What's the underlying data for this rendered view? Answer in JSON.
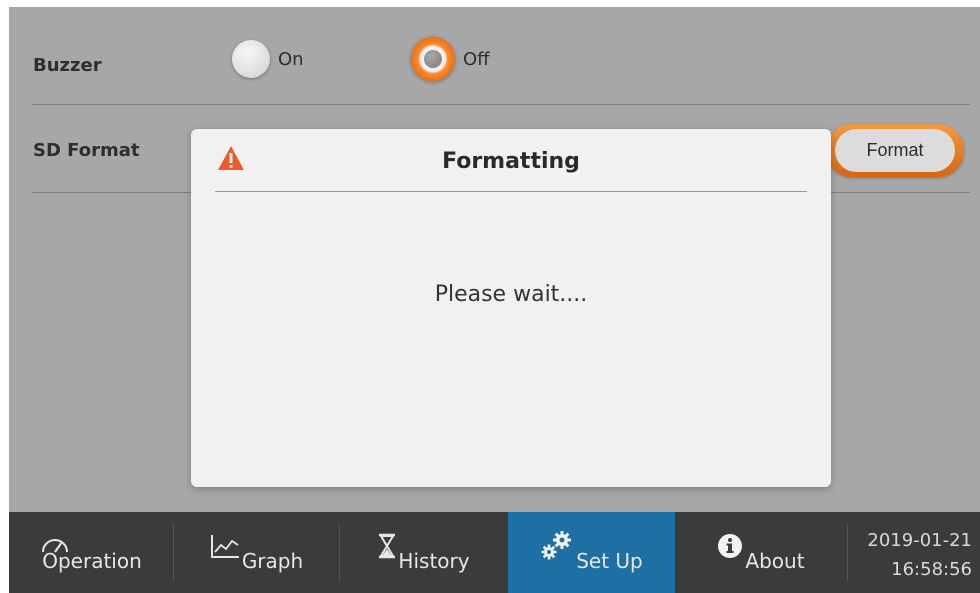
{
  "settings": {
    "buzzer": {
      "label": "Buzzer",
      "on_label": "On",
      "off_label": "Off",
      "selected": "Off"
    },
    "sd_format": {
      "label": "SD Format",
      "button_label": "Format"
    }
  },
  "dialog": {
    "title": "Formatting",
    "message": "Please wait....",
    "icon": "warning-icon"
  },
  "nav": {
    "items": [
      {
        "label": "Operation",
        "icon": "gauge-icon"
      },
      {
        "label": "Graph",
        "icon": "line-chart-icon"
      },
      {
        "label": "History",
        "icon": "hourglass-icon"
      },
      {
        "label": "Set Up",
        "icon": "gears-icon"
      },
      {
        "label": "About",
        "icon": "info-icon"
      }
    ],
    "active": "Set Up"
  },
  "clock": {
    "date": "2019-01-21",
    "time": "16:58:56"
  },
  "colors": {
    "background": "#a7a7a7",
    "accent_orange": "#e46c12",
    "nav_background": "#3b3b3b",
    "nav_active": "#1e6fa3",
    "warning": "#f05a28"
  }
}
